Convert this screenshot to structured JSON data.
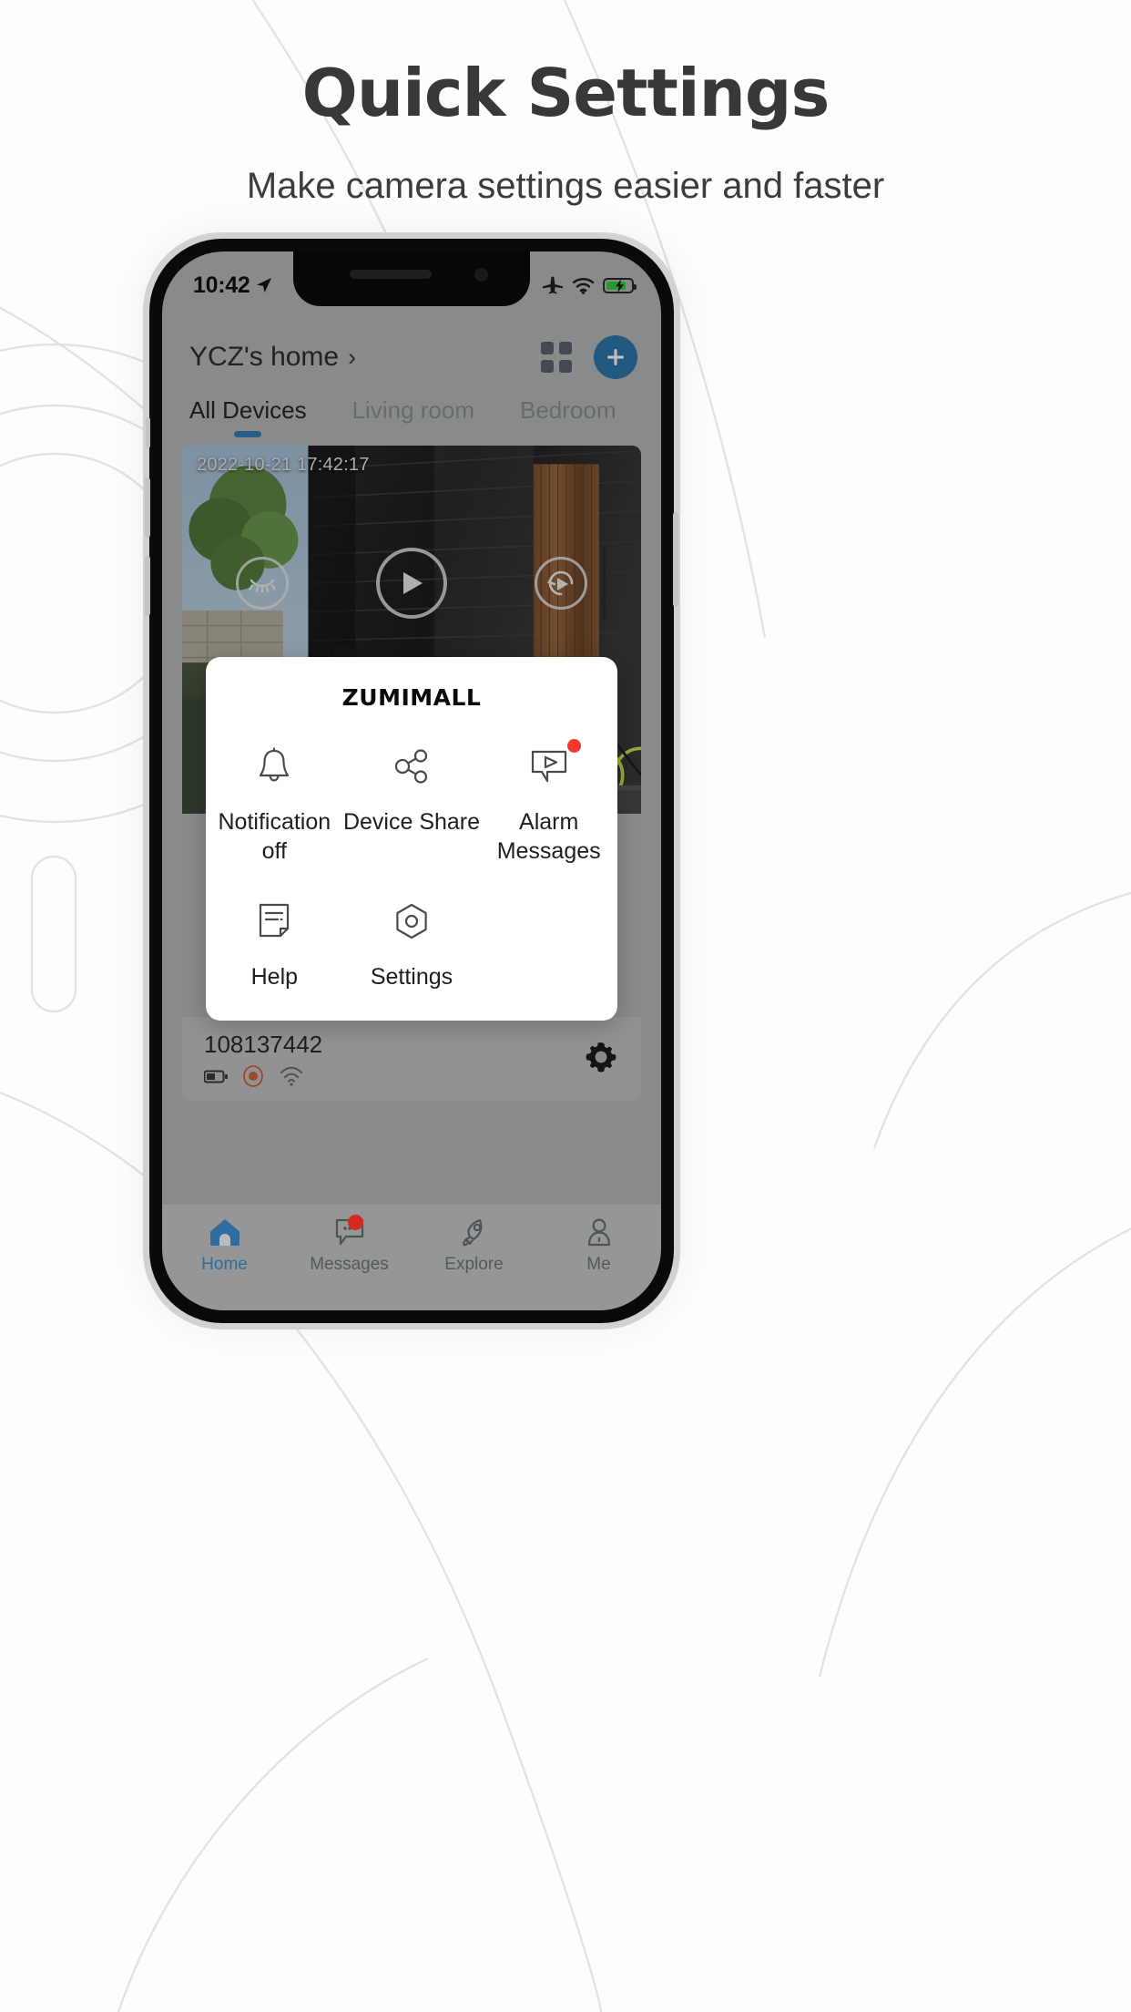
{
  "page": {
    "headline": "Quick Settings",
    "subhead": "Make camera settings easier and faster"
  },
  "phone": {
    "statusbar": {
      "time": "10:42",
      "location_icon": "location-arrow-icon",
      "airplane_icon": "airplane-mode-icon",
      "wifi_icon": "wifi-icon",
      "battery_icon": "battery-charging-icon",
      "battery_color": "#35d03f"
    },
    "header": {
      "home_name": "YCZ's home",
      "chevron": "›",
      "grid_icon": "grid-view-icon",
      "add_label": "+",
      "accent_color": "#2f78ad"
    },
    "tabs": [
      {
        "label": "All Devices",
        "active": true
      },
      {
        "label": "Living room",
        "active": false
      },
      {
        "label": "Bedroom",
        "active": false
      }
    ],
    "menu_icon": "hamburger-menu-icon",
    "camera": {
      "timestamp": "2022-10-21 17:42:17",
      "controls": [
        {
          "name": "privacy-eye-off-icon"
        },
        {
          "name": "play-icon"
        },
        {
          "name": "replay-play-icon"
        }
      ]
    },
    "device": {
      "id": "108137442",
      "status_icons": [
        "battery-icon",
        "record-dot-icon",
        "wifi-signal-icon"
      ],
      "settings_icon": "gear-icon"
    },
    "modal": {
      "brand": "ZUMIMALL",
      "items": [
        {
          "label": "Notification off",
          "icon": "bell-icon",
          "badge": false
        },
        {
          "label": "Device Share",
          "icon": "share-nodes-icon",
          "badge": false
        },
        {
          "label": "Alarm Messages",
          "icon": "video-message-icon",
          "badge": true
        },
        {
          "label": "Help",
          "icon": "document-icon",
          "badge": false
        },
        {
          "label": "Settings",
          "icon": "hexagon-gear-icon",
          "badge": false
        }
      ]
    },
    "bottom_nav": [
      {
        "label": "Home",
        "icon": "home-icon",
        "active": true,
        "badge": false
      },
      {
        "label": "Messages",
        "icon": "chat-bubble-icon",
        "active": false,
        "badge": true
      },
      {
        "label": "Explore",
        "icon": "rocket-icon",
        "active": false,
        "badge": false
      },
      {
        "label": "Me",
        "icon": "person-icon",
        "active": false,
        "badge": false
      }
    ]
  },
  "colors": {
    "accent": "#2f78ad",
    "badge_red": "#f2392c",
    "battery_green": "#35d03f",
    "heading": "#383838"
  }
}
